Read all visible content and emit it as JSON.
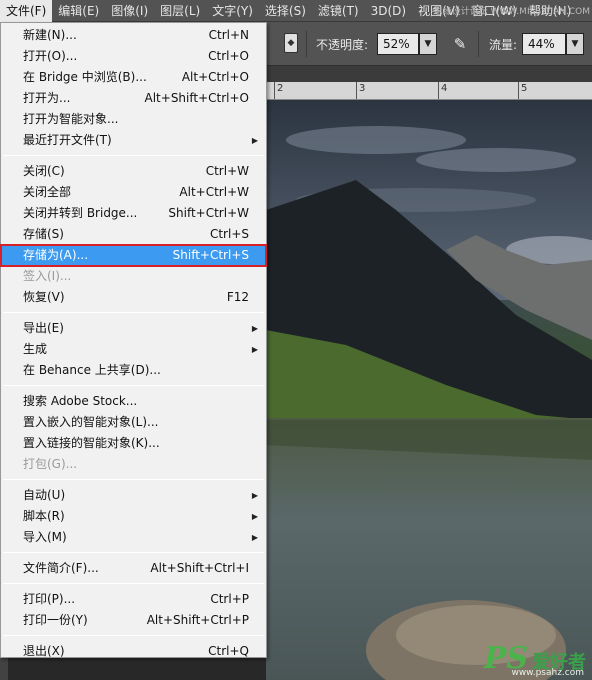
{
  "menubar": {
    "items": [
      "文件(F)",
      "编辑(E)",
      "图像(I)",
      "图层(L)",
      "文字(Y)",
      "选择(S)",
      "滤镜(T)",
      "3D(D)",
      "视图(V)",
      "窗口(W)",
      "帮助(H)"
    ],
    "overlay_text": "思缘设计论坛  WWW.MISSYUAN.COM"
  },
  "options": {
    "opacity_label": "不透明度:",
    "opacity_value": "52%",
    "flow_label": "流量:",
    "flow_value": "44%",
    "brush_icon": "airbrush-icon"
  },
  "ruler": {
    "numbers": [
      "2",
      "3",
      "4",
      "5"
    ]
  },
  "file_menu": {
    "items": [
      {
        "label": "新建(N)...",
        "shortcut": "Ctrl+N"
      },
      {
        "label": "打开(O)...",
        "shortcut": "Ctrl+O"
      },
      {
        "label": "在 Bridge 中浏览(B)...",
        "shortcut": "Alt+Ctrl+O"
      },
      {
        "label": "打开为...",
        "shortcut": "Alt+Shift+Ctrl+O"
      },
      {
        "label": "打开为智能对象...",
        "shortcut": ""
      },
      {
        "label": "最近打开文件(T)",
        "shortcut": "",
        "submenu": true
      },
      {
        "divider": true
      },
      {
        "label": "关闭(C)",
        "shortcut": "Ctrl+W"
      },
      {
        "label": "关闭全部",
        "shortcut": "Alt+Ctrl+W"
      },
      {
        "label": "关闭并转到 Bridge...",
        "shortcut": "Shift+Ctrl+W"
      },
      {
        "label": "存储(S)",
        "shortcut": "Ctrl+S"
      },
      {
        "label": "存储为(A)...",
        "shortcut": "Shift+Ctrl+S",
        "highlighted": true
      },
      {
        "label": "签入(I)...",
        "shortcut": "",
        "disabled": true
      },
      {
        "label": "恢复(V)",
        "shortcut": "F12"
      },
      {
        "divider": true
      },
      {
        "label": "导出(E)",
        "shortcut": "",
        "submenu": true
      },
      {
        "label": "生成",
        "shortcut": "",
        "submenu": true
      },
      {
        "label": "在 Behance 上共享(D)...",
        "shortcut": ""
      },
      {
        "divider": true
      },
      {
        "label": "搜索 Adobe Stock...",
        "shortcut": ""
      },
      {
        "label": "置入嵌入的智能对象(L)...",
        "shortcut": ""
      },
      {
        "label": "置入链接的智能对象(K)...",
        "shortcut": ""
      },
      {
        "label": "打包(G)...",
        "shortcut": "",
        "disabled": true
      },
      {
        "divider": true
      },
      {
        "label": "自动(U)",
        "shortcut": "",
        "submenu": true
      },
      {
        "label": "脚本(R)",
        "shortcut": "",
        "submenu": true
      },
      {
        "label": "导入(M)",
        "shortcut": "",
        "submenu": true
      },
      {
        "divider": true
      },
      {
        "label": "文件简介(F)...",
        "shortcut": "Alt+Shift+Ctrl+I"
      },
      {
        "divider": true
      },
      {
        "label": "打印(P)...",
        "shortcut": "Ctrl+P"
      },
      {
        "label": "打印一份(Y)",
        "shortcut": "Alt+Shift+Ctrl+P"
      },
      {
        "divider": true
      },
      {
        "label": "退出(X)",
        "shortcut": "Ctrl+Q"
      }
    ]
  },
  "watermark": {
    "ps": "PS",
    "cn": "爱好者",
    "site": "www.psahz.com"
  },
  "colors": {
    "highlight": "#3c9bf0",
    "highlight_border": "#d6202a",
    "menu_bg": "#f1f1f1"
  }
}
